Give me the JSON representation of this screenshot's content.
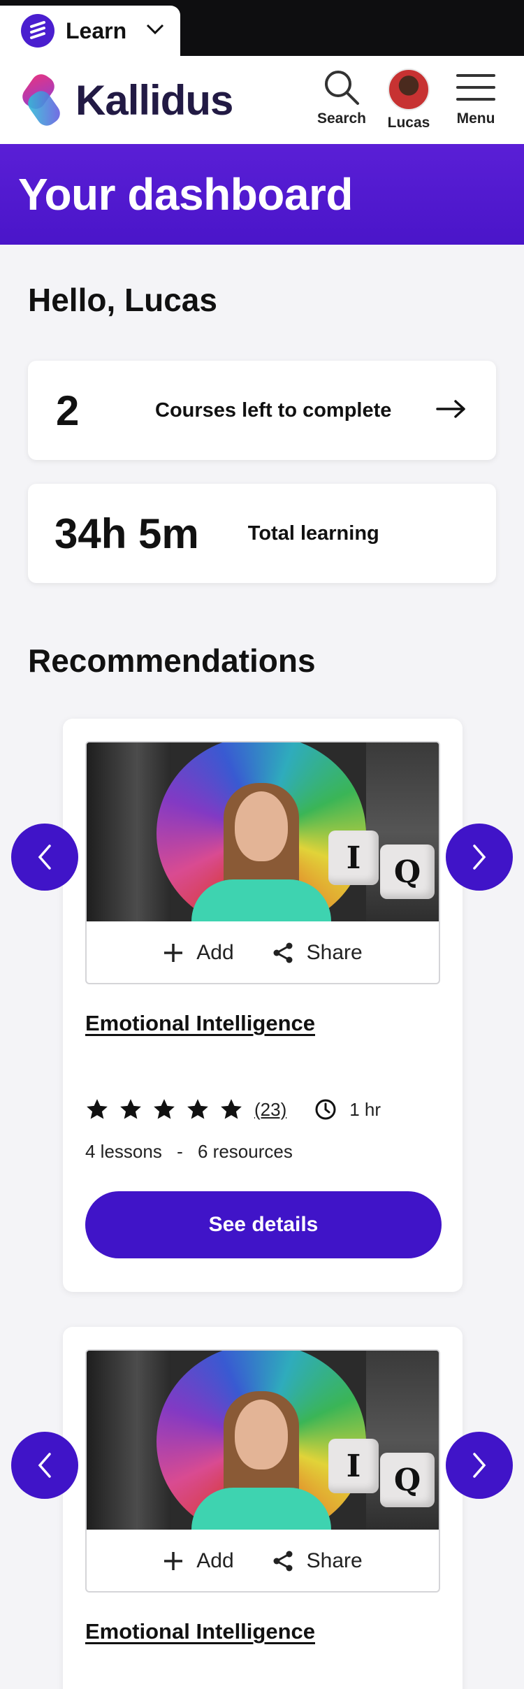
{
  "app_switcher": {
    "label": "Learn"
  },
  "header": {
    "brand": "Kallidus",
    "search_label": "Search",
    "profile_label": "Lucas",
    "menu_label": "Menu"
  },
  "banner": {
    "title": "Your dashboard"
  },
  "greeting": "Hello, Lucas",
  "stats": {
    "courses_left": {
      "value": "2",
      "label": "Courses left to complete"
    },
    "total_learning": {
      "value": "34h 5m",
      "label": "Total learning"
    }
  },
  "recommendations": {
    "title": "Recommendations",
    "add_label": "Add",
    "share_label": "Share",
    "items": [
      {
        "title": "Emotional Intelligence",
        "rating": 5,
        "rating_count": "(23)",
        "duration": "1 hr",
        "lessons": "4 lessons",
        "separator": "-",
        "resources": "6 resources",
        "cta": "See details"
      },
      {
        "title": "Emotional Intelligence"
      }
    ]
  },
  "colors": {
    "primary": "#4014c8",
    "banner": "#5a1fd6",
    "brand_text": "#221a44"
  }
}
